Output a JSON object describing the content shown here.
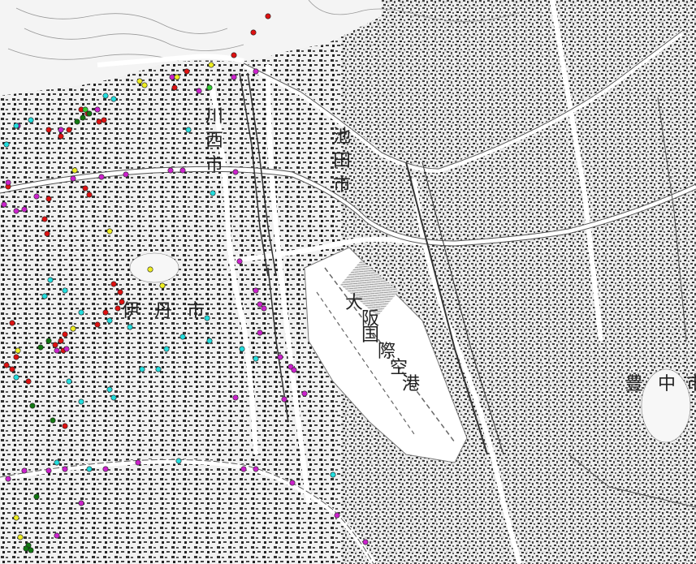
{
  "map": {
    "labels": {
      "area_city_1": "川",
      "area_city_2": "西",
      "area_city_3": "市",
      "area_city_4": "伊",
      "area_city_5": "丹",
      "area_city_6": "市",
      "area_city_7": "池",
      "area_city_8": "田",
      "area_city_9": "市",
      "area_city_10": "豊",
      "area_city_11": "中",
      "area_city_12": "市",
      "airport_1": "大",
      "airport_2": "阪",
      "airport_3": "国",
      "airport_4": "際",
      "airport_5": "空",
      "airport_6": "港"
    },
    "marker_colors": {
      "red": "#dd1111",
      "magenta": "#cc22cc",
      "cyan": "#22dddd",
      "yellow": "#eeee22",
      "green": "#117711",
      "lime": "#33cc33"
    }
  }
}
